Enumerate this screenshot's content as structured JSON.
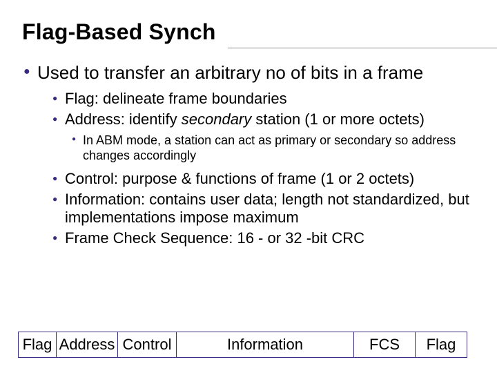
{
  "title": "Flag-Based Synch",
  "level1": {
    "text": "Used to transfer an arbitrary no of bits in a frame"
  },
  "level2": {
    "a": "Flag:  delineate frame boundaries",
    "b_pre": "Address: identify ",
    "b_em": "secondary",
    "b_post": " station (1 or more octets)",
    "c": "Control:  purpose & functions of frame (1 or 2 octets)",
    "d": "Information:  contains user data;  length not standardized, but implementations impose maximum",
    "e": "Frame Check Sequence:  16 - or 32 -bit CRC"
  },
  "level3": {
    "a": "In ABM mode, a station can act as primary or secondary so address changes accordingly"
  },
  "frame": {
    "flag": "Flag",
    "address": "Address",
    "control": "Control",
    "information": "Information",
    "fcs": "FCS",
    "flag2": "Flag"
  }
}
